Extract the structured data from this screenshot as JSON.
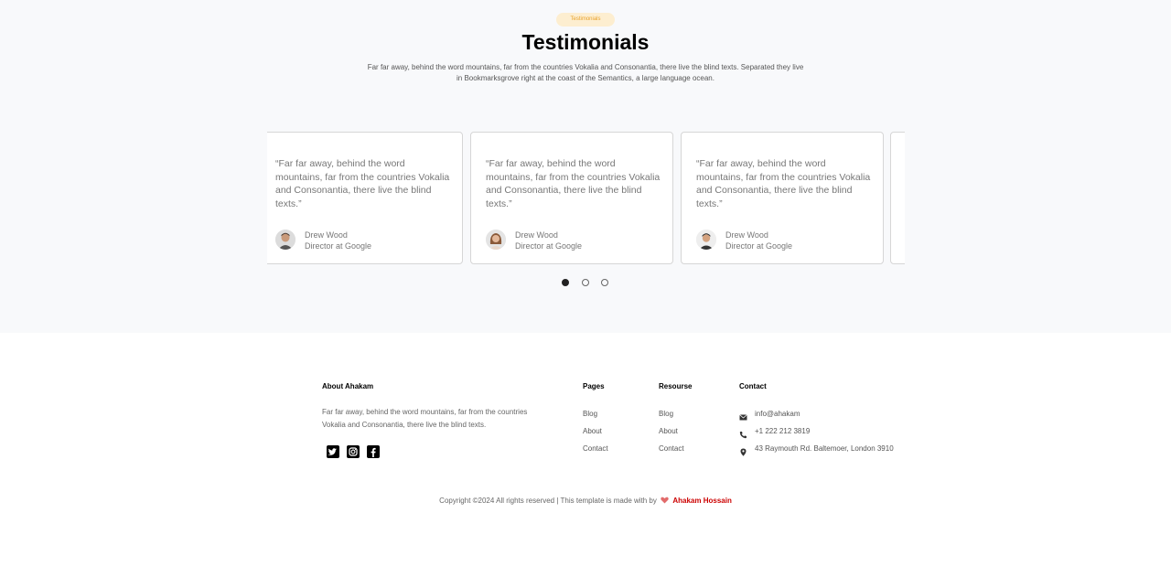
{
  "testimonials": {
    "badge": "Testimonials",
    "title": "Testimonials",
    "description": "Far far away, behind the word mountains, far from the countries Vokalia and Consonantia, there live the blind texts. Separated they live in Bookmarksgrove right at the coast of the Semantics, a large language ocean.",
    "cards": [
      {
        "quote": "“Far far away, behind the word mountains, far from the countries Vokalia and Consonantia, there live the blind texts.”",
        "name": "Drew Wood",
        "role": "Director at Google"
      },
      {
        "quote": "“Far far away, behind the word mountains, far from the countries Vokalia and Consonantia, there live the blind texts.”",
        "name": "Drew Wood",
        "role": "Director at Google"
      },
      {
        "quote": "“Far far away, behind the word mountains, far from the countries Vokalia and Consonantia, there live the blind texts.”",
        "name": "Drew Wood",
        "role": "Director at Google"
      }
    ],
    "pagination": {
      "count": 3,
      "active": 1
    }
  },
  "footer": {
    "about": {
      "heading": "About Ahakam",
      "text": "Far far away, behind the word mountains, far from the countries Vokalia and Consonantia, there live the blind texts.",
      "social": [
        "twitter-icon",
        "instagram-icon",
        "facebook-icon"
      ]
    },
    "pages": {
      "heading": "Pages",
      "links": [
        "Blog",
        "About",
        "Contact"
      ]
    },
    "resources": {
      "heading": "Resourse",
      "links": [
        "Blog",
        "About",
        "Contact"
      ]
    },
    "contact": {
      "heading": "Contact",
      "email": "info@ahakam",
      "phone": "+1 222 212 3819",
      "address": "43 Raymouth Rd. Baltemoer, London 3910"
    },
    "copyright": {
      "text": "Copyright ©2024 All rights reserved | This template is made with by",
      "author": "Ahakam Hossain"
    }
  },
  "colors": {
    "accent_badge_bg": "#fdeed0",
    "accent_badge_text": "#e8a12a",
    "heart": "#e26b6b",
    "author": "#cc0000"
  }
}
